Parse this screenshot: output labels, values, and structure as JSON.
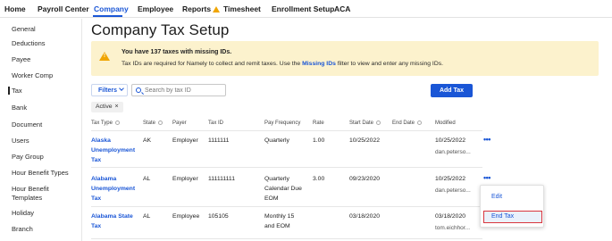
{
  "nav": {
    "items": [
      "Home",
      "Payroll Center",
      "Company",
      "Employee",
      "Reports",
      "Timesheet",
      "Enrollment Setup",
      "ACA"
    ],
    "active": "Company",
    "reports_badge_icon": "warning-icon"
  },
  "sidebar": {
    "items": [
      "General",
      "Deductions",
      "Payee",
      "Worker Comp",
      "Tax",
      "Bank",
      "Document",
      "Users",
      "Pay Group",
      "Hour Benefit Types",
      "Hour Benefit Templates",
      "Holiday",
      "Branch"
    ],
    "active": "Tax"
  },
  "page": {
    "title": "Company Tax Setup"
  },
  "alert": {
    "title": "You have 137 taxes with missing IDs.",
    "body_prefix": "Tax IDs are required for Namely to collect and remit taxes. Use the ",
    "body_link": "Missing IDs",
    "body_suffix": " filter to view and enter any missing IDs.",
    "icon": "warning-icon",
    "bg_color": "#fcf2cd"
  },
  "toolbar": {
    "filters_label": "Filters",
    "search_placeholder": "Search by tax ID",
    "add_label": "Add Tax",
    "accent": "#1a56d6"
  },
  "chip": {
    "label": "Active",
    "close": "×"
  },
  "table": {
    "headers": [
      "Tax Type",
      "State",
      "Payer",
      "Tax ID",
      "Pay Frequency",
      "Rate",
      "Start Date",
      "End Date",
      "Modified"
    ],
    "rows": [
      {
        "tax_type": [
          "Alaska",
          "Unemployment",
          "Tax"
        ],
        "state": "AK",
        "payer": "Employer",
        "tax_id": "1111111",
        "pay_frequency": [
          "Quarterly"
        ],
        "rate": "1.00",
        "start_date": "10/25/2022",
        "end_date": "",
        "modified": "10/25/2022",
        "modified_by": "dan.peterso..."
      },
      {
        "tax_type": [
          "Alabama",
          "Unemployment",
          "Tax"
        ],
        "state": "AL",
        "payer": "Employer",
        "tax_id": "111111111",
        "pay_frequency": [
          "Quarterly",
          "Calendar Due",
          "EOM"
        ],
        "rate": "3.00",
        "start_date": "09/23/2020",
        "end_date": "",
        "modified": "10/25/2022",
        "modified_by": "dan.peterso..."
      },
      {
        "tax_type": [
          "Alabama State",
          "Tax"
        ],
        "state": "AL",
        "payer": "Employee",
        "tax_id": "105105",
        "pay_frequency": [
          "Monthly 15",
          "and EOM"
        ],
        "rate": "",
        "start_date": "03/18/2020",
        "end_date": "",
        "modified": "03/18/2020",
        "modified_by": "tom.eichhor..."
      }
    ],
    "row_menu_icon": "more-horizontal-icon"
  },
  "row_menu": {
    "items": [
      "Edit",
      "End Tax"
    ],
    "highlighted": "End Tax",
    "highlight_border": "#d9353d"
  }
}
